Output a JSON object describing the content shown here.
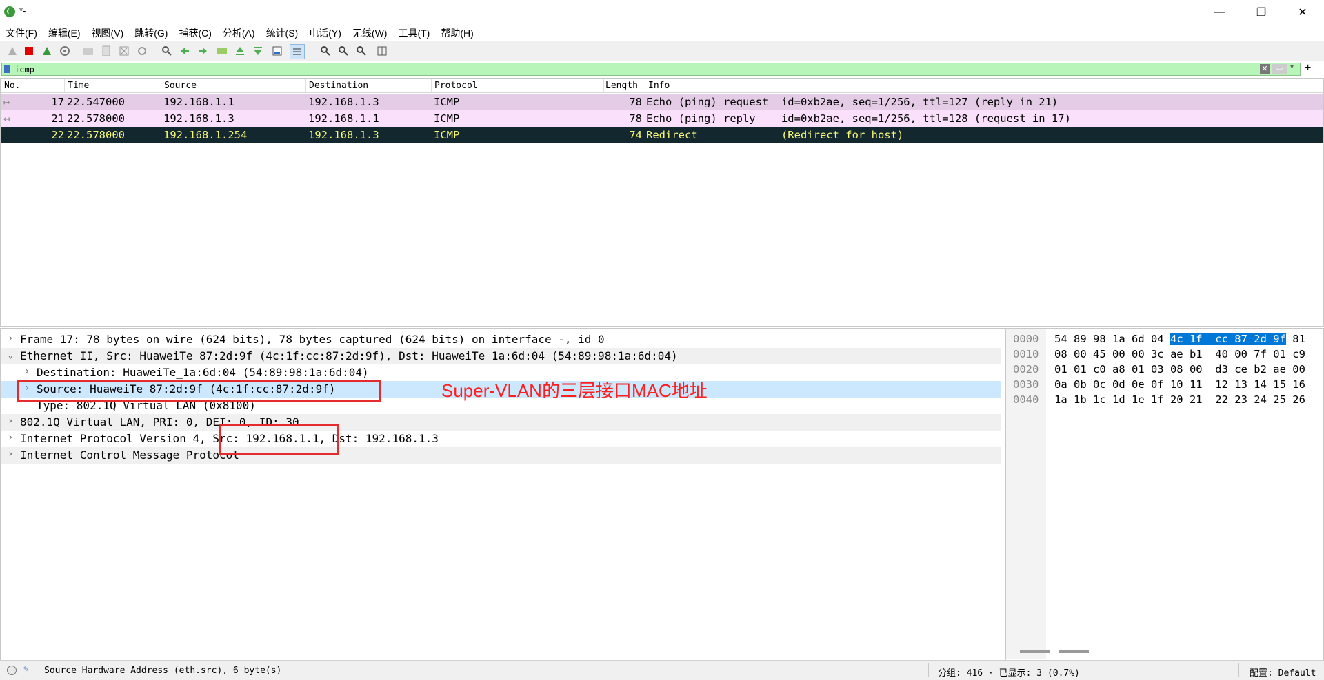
{
  "window": {
    "title": "*-"
  },
  "menu": [
    "文件(F)",
    "编辑(E)",
    "视图(V)",
    "跳转(G)",
    "捕获(C)",
    "分析(A)",
    "统计(S)",
    "电话(Y)",
    "无线(W)",
    "工具(T)",
    "帮助(H)"
  ],
  "filter": {
    "value": "icmp",
    "plus": "+"
  },
  "columns": [
    "No.",
    "Time",
    "Source",
    "Destination",
    "Protocol",
    "Length",
    "Info"
  ],
  "packets": [
    {
      "no": "17",
      "time": "22.547000",
      "source": "192.168.1.1",
      "destination": "192.168.1.3",
      "protocol": "ICMP",
      "length": "78",
      "info": "Echo (ping) request  id=0xb2ae, seq=1/256, ttl=127 (reply in 21)"
    },
    {
      "no": "21",
      "time": "22.578000",
      "source": "192.168.1.3",
      "destination": "192.168.1.1",
      "protocol": "ICMP",
      "length": "78",
      "info": "Echo (ping) reply    id=0xb2ae, seq=1/256, ttl=128 (request in 17)"
    },
    {
      "no": "22",
      "time": "22.578000",
      "source": "192.168.1.254",
      "destination": "192.168.1.3",
      "protocol": "ICMP",
      "length": "74",
      "info": "Redirect             (Redirect for host)"
    }
  ],
  "details": [
    {
      "text": "Frame 17: 78 bytes on wire (624 bits), 78 bytes captured (624 bits) on interface -, id 0",
      "chev": "›"
    },
    {
      "text": "Ethernet II, Src: HuaweiTe_87:2d:9f (4c:1f:cc:87:2d:9f), Dst: HuaweiTe_1a:6d:04 (54:89:98:1a:6d:04)",
      "chev": "⌄"
    },
    {
      "text": "Destination: HuaweiTe_1a:6d:04 (54:89:98:1a:6d:04)",
      "chev": "›"
    },
    {
      "text": "Source: HuaweiTe_87:2d:9f (4c:1f:cc:87:2d:9f)",
      "chev": "›"
    },
    {
      "text": "Type: 802.1Q Virtual LAN (0x8100)",
      "chev": ""
    },
    {
      "text": "802.1Q Virtual LAN, PRI: 0, DEI: 0, ID: 30",
      "chev": "›"
    },
    {
      "text": "Internet Protocol Version 4, Src: 192.168.1.1, Dst: 192.168.1.3",
      "chev": "›"
    },
    {
      "text": "Internet Control Message Protocol",
      "chev": "›"
    }
  ],
  "annotation": "Super-VLAN的三层接口MAC地址",
  "hex": [
    {
      "offset": "0000",
      "pre": "54 89 98 1a 6d 04 ",
      "sel": "4c 1f  cc 87 2d 9f",
      "post": " 81"
    },
    {
      "offset": "0010",
      "pre": "08 00 45 00 00 3c ae b1  40 00 7f 01 c9",
      "sel": "",
      "post": ""
    },
    {
      "offset": "0020",
      "pre": "01 01 c0 a8 01 03 08 00  d3 ce b2 ae 00",
      "sel": "",
      "post": ""
    },
    {
      "offset": "0030",
      "pre": "0a 0b 0c 0d 0e 0f 10 11  12 13 14 15 16",
      "sel": "",
      "post": ""
    },
    {
      "offset": "0040",
      "pre": "1a 1b 1c 1d 1e 1f 20 21  22 23 24 25 26",
      "sel": "",
      "post": ""
    }
  ],
  "status": {
    "field": "Source Hardware Address (eth.src), 6 byte(s)",
    "packets": "分组: 416 · 已显示: 3 (0.7%)",
    "profile": "配置: Default"
  },
  "colors": {
    "row_request": "#e4cce6",
    "row_reply": "#fae0fa",
    "row_selected_bg": "#12272e",
    "row_selected_fg": "#f7f77a",
    "detail_highlight": "#cce8ff",
    "hex_selected": "#0078d7",
    "annotation": "#ff1f1f"
  }
}
